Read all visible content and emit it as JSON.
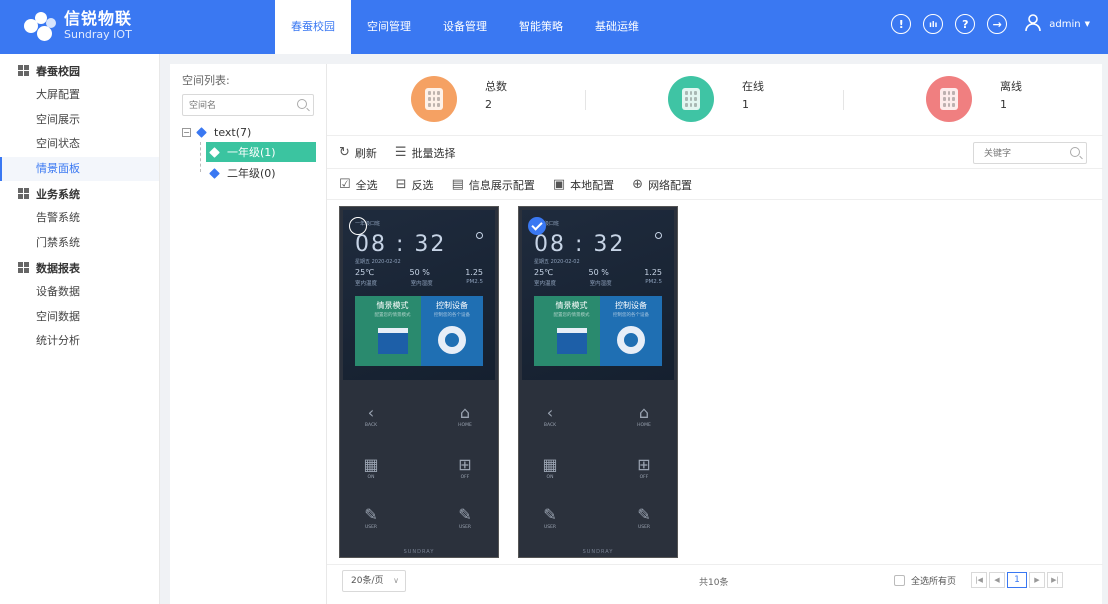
{
  "brand": {
    "name_cn": "信锐物联",
    "name_en": "Sundray IOT",
    "logo_icon": "hexagon-cluster-logo"
  },
  "nav": {
    "tabs": [
      {
        "label": "春蚕校园",
        "active": true
      },
      {
        "label": "空间管理",
        "active": false
      },
      {
        "label": "设备管理",
        "active": false
      },
      {
        "label": "智能策略",
        "active": false
      },
      {
        "label": "基础运维",
        "active": false
      }
    ]
  },
  "header_icons": [
    "info-icon",
    "chart-icon",
    "help-icon",
    "logout-icon"
  ],
  "user": {
    "name": "admin",
    "icon": "user-icon"
  },
  "sidebar": {
    "groups": [
      {
        "label": "春蚕校园",
        "items": [
          "大屏配置",
          "空间展示",
          "空间状态",
          "情景面板"
        ]
      },
      {
        "label": "业务系统",
        "items": [
          "告警系统",
          "门禁系统"
        ]
      },
      {
        "label": "数据报表",
        "items": [
          "设备数据",
          "空间数据",
          "统计分析"
        ]
      }
    ],
    "active_item": "情景面板"
  },
  "space_list": {
    "title": "空间列表:",
    "search_placeholder": "空间名",
    "root": "text(7)",
    "children": [
      {
        "label": "一年级(1)",
        "selected": true
      },
      {
        "label": "二年级(0)",
        "selected": false
      }
    ]
  },
  "stats": [
    {
      "label": "总数",
      "value": "2",
      "color": "#f5a163"
    },
    {
      "label": "在线",
      "value": "1",
      "color": "#3fc4a4"
    },
    {
      "label": "离线",
      "value": "1",
      "color": "#f07f80"
    }
  ],
  "toolbar": {
    "refresh": "刷新",
    "batch_select": "批量选择",
    "keyword_placeholder": "关键字"
  },
  "actions": {
    "select_all": "全选",
    "invert": "反选",
    "info_display": "信息展示配置",
    "local_config": "本地配置",
    "network_config": "网络配置"
  },
  "devices": [
    {
      "selected": false
    },
    {
      "selected": true
    }
  ],
  "device_screen": {
    "title": "一年级口班",
    "time": "08 : 32",
    "date": "星期五 2020-02-02",
    "temp": "25℃",
    "temp_label": "室内温度",
    "humidity": "50 %",
    "humidity_label": "室内湿度",
    "pm": "1.25",
    "pm_label": "PM2.5",
    "card1_title": "情景模式",
    "card1_sub": "配置您的情景模式",
    "card2_title": "控制设备",
    "card2_sub": "控制您的各个设备",
    "keys": [
      "BACK",
      "HOME",
      "ON",
      "OFF",
      "USER",
      "USER"
    ],
    "brand": "SUNDRAY"
  },
  "footer": {
    "page_size": "20条/页",
    "total": "共10条",
    "select_all_pages": "全选所有页",
    "current_page": "1"
  }
}
